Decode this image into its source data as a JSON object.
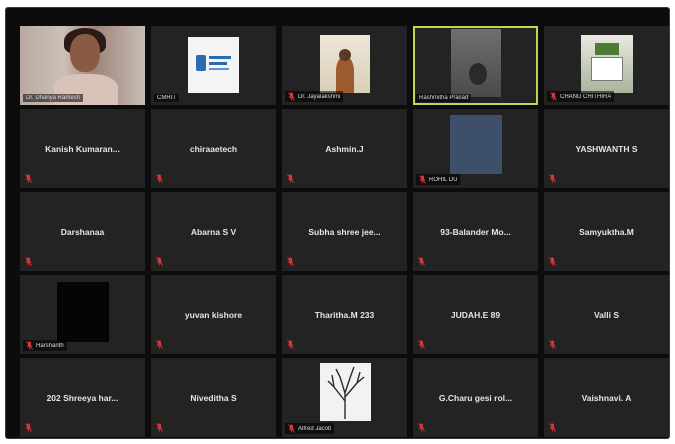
{
  "meeting": {
    "participants": [
      {
        "display": "video",
        "label": "Dr. Dhanya Ramesh",
        "mic": "on",
        "speaking": false,
        "thumb": "photo-a"
      },
      {
        "display": "video",
        "label": "CMRIT",
        "mic": "on",
        "speaking": false,
        "thumb": "logo"
      },
      {
        "display": "video",
        "label": "Dr. Jayalakshmi",
        "mic": "muted",
        "speaking": false,
        "thumb": "photo-c"
      },
      {
        "display": "video",
        "label": "Rashmitha Prasad",
        "mic": "on",
        "speaking": true,
        "thumb": "photo-d"
      },
      {
        "display": "video",
        "label": "CHAND CHITHIRA",
        "mic": "muted",
        "speaking": false,
        "thumb": "photo-e"
      },
      {
        "display": "name",
        "name": "Kanish Kumaran...",
        "mic": "muted"
      },
      {
        "display": "name",
        "name": "chiraaetech",
        "mic": "muted"
      },
      {
        "display": "name",
        "name": "Ashmin.J",
        "mic": "muted"
      },
      {
        "display": "video",
        "label": "ROHIL DU",
        "mic": "muted",
        "speaking": false,
        "thumb": "blue"
      },
      {
        "display": "name",
        "name": "YASHWANTH S",
        "mic": "muted"
      },
      {
        "display": "name",
        "name": "Darshanaa",
        "mic": "muted"
      },
      {
        "display": "name",
        "name": "Abarna S V",
        "mic": "muted"
      },
      {
        "display": "name",
        "name": "Subha shree jee...",
        "mic": "muted"
      },
      {
        "display": "name",
        "name": "93-Balander Mo...",
        "mic": "muted"
      },
      {
        "display": "name",
        "name": "Samyuktha.M",
        "mic": "muted"
      },
      {
        "display": "video",
        "label": "Harshanth",
        "mic": "muted",
        "speaking": false,
        "thumb": "black"
      },
      {
        "display": "name",
        "name": "yuvan kishore",
        "mic": "muted"
      },
      {
        "display": "name",
        "name": "Tharitha.M 233",
        "mic": "muted"
      },
      {
        "display": "name",
        "name": "JUDAH.E 89",
        "mic": "muted"
      },
      {
        "display": "name",
        "name": "Valli S",
        "mic": "muted"
      },
      {
        "display": "name",
        "name": "202 Shreeya har...",
        "mic": "muted"
      },
      {
        "display": "name",
        "name": "Niveditha S",
        "mic": "muted"
      },
      {
        "display": "video",
        "label": "Alfred Jacob",
        "mic": "muted",
        "speaking": false,
        "thumb": "tree"
      },
      {
        "display": "name",
        "name": "G.Charu gesi rol...",
        "mic": "muted"
      },
      {
        "display": "name",
        "name": "Vaishnavi. A",
        "mic": "muted"
      }
    ]
  },
  "colors": {
    "background": "#0c0c0c",
    "tile": "#232323",
    "speaking_border": "#c8d24a",
    "muted_mic": "#e0343a"
  },
  "icons": {
    "muted": "mic-muted-icon",
    "on": "mic-icon"
  }
}
